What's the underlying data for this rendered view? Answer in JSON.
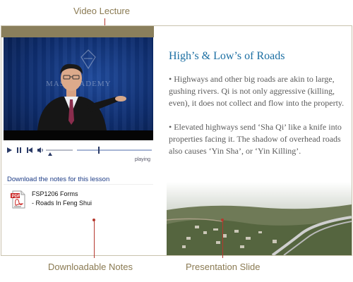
{
  "callouts": {
    "video": "Video Lecture",
    "notes": "Downloadable Notes",
    "slide": "Presentation Slide"
  },
  "video": {
    "watermark": "MAS     ACADEMY",
    "status": "playing"
  },
  "controls": {
    "play_icon": "play-icon",
    "pause_icon": "pause-icon",
    "prev_icon": "skip-back-icon",
    "volume_icon": "volume-icon"
  },
  "download": {
    "label": "Download the notes for this lesson",
    "file_icon": "pdf-icon",
    "file_line1": "FSP1206 Forms",
    "file_line2": "- Roads In Feng Shui",
    "pdf_badge": "PDF",
    "adobe_text": "Adobe"
  },
  "slide": {
    "title": "High’s & Low’s of Roads",
    "bullets": [
      "• Highways and other big roads are akin to large, gushing rivers.  Qi is not only aggressive (killing, even), it does not collect and flow into the property.",
      "• Elevated highways send ‘Sha Qi’ like a knife into properties facing it. The shadow of overhead roads also causes ‘Yin Sha’, or ‘Yin Killing’."
    ]
  },
  "colors": {
    "accent": "#1b6ea2",
    "callout": "#8a7a52",
    "leader": "#b5382e",
    "frame_bar": "#8a7f5c"
  }
}
